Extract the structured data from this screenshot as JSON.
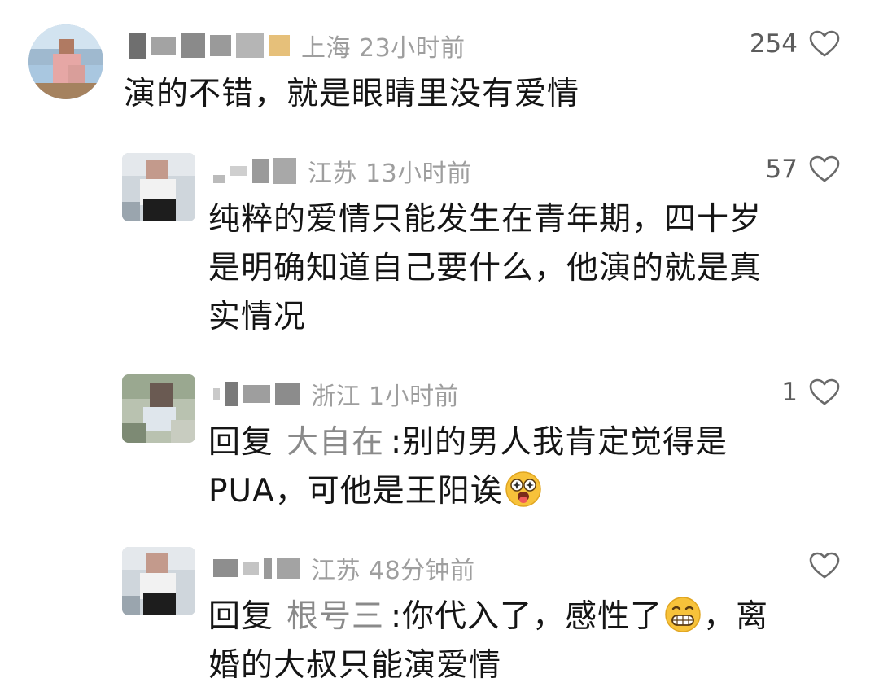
{
  "comments": [
    {
      "location": "上海",
      "time": "23小时前",
      "likes": "254",
      "text": "演的不错，就是眼睛里没有爱情"
    },
    {
      "location": "江苏",
      "time": "13小时前",
      "likes": "57",
      "lines": [
        "纯粹的爱情只能发生在青年期，四十岁",
        "是明确知道自己要什么，他演的就是真",
        "实情况"
      ]
    },
    {
      "location": "浙江",
      "time": "1小时前",
      "likes": "1",
      "reply_label": "回复",
      "reply_target": "大自在",
      "line1": ":别的男人我肯定觉得是",
      "line2": "PUA，可他是王阳诶"
    },
    {
      "location": "江苏",
      "time": "48分钟前",
      "likes": "",
      "reply_label": "回复",
      "reply_target": "根号三",
      "line1_a": ":你代入了，感性了",
      "line1_b": "，离",
      "line2": "婚的大叔只能演爱情"
    }
  ],
  "icons": {
    "like": "heart-outline-icon",
    "emoji_1": "starry-eyed-tongue-emoji",
    "emoji_2": "grinning-teeth-emoji"
  },
  "colors": {
    "meta": "#9e9e9e",
    "text": "#151515",
    "reply_target": "#8a8a8a",
    "like_count": "#5c5c5c"
  }
}
